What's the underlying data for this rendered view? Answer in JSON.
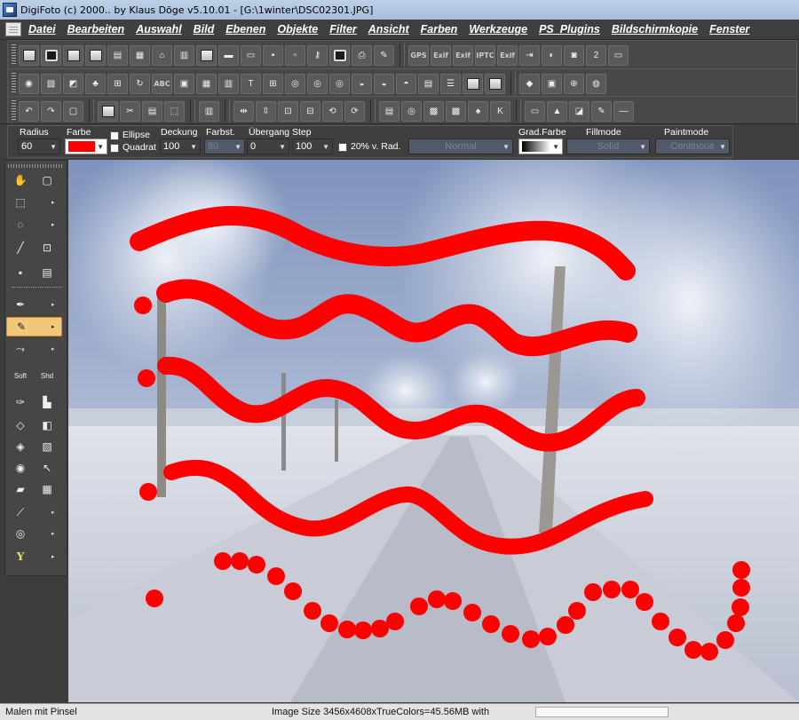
{
  "window": {
    "title": "DigiFoto (c) 2000.. by Klaus Döge v5.10.01 - [G:\\1winter\\DSC02301.JPG]"
  },
  "menu": [
    "Datei",
    "Bearbeiten",
    "Auswahl",
    "Bild",
    "Ebenen",
    "Objekte",
    "Filter",
    "Ansicht",
    "Farben",
    "Werkzeuge",
    "PS_Plugins",
    "Bildschirmkopie",
    "Fenster"
  ],
  "toolbar": {
    "row1_text_icons": [
      "GPS",
      "Exif",
      "Exif",
      "IPTC",
      "Exif"
    ],
    "row1_num_label": "2",
    "row2_text_icons": [
      "ABC"
    ]
  },
  "props": {
    "radius": {
      "label": "Radius",
      "value": "60"
    },
    "farbe": {
      "label": "Farbe",
      "color": "#ff0000"
    },
    "ellipse": {
      "label": "Ellipse",
      "checked": false
    },
    "quadrat": {
      "label": "Quadrat",
      "checked": false
    },
    "deckung": {
      "label": "Deckung",
      "value": "100"
    },
    "farbst": {
      "label": "Farbst.",
      "value": "80"
    },
    "uebergang": {
      "label": "Übergang",
      "value": "0"
    },
    "step": {
      "label": "Step",
      "value": "100"
    },
    "rad": {
      "label": "20% v. Rad.",
      "checked": false
    },
    "blend": {
      "value": "Normal"
    },
    "gradfarbe": {
      "label": "Grad.Farbe"
    },
    "fillmode": {
      "label": "Fillmode",
      "value": "Solid"
    },
    "paintmode": {
      "label": "Paintmode",
      "value": "Continous"
    }
  },
  "tools": {
    "brush_labels": [
      "Soft",
      "Shd"
    ],
    "text_tool": "Y"
  },
  "status": {
    "mode": "Malen mit Pinsel",
    "info": "Image Size 3456x4608xTrueColors=45.56MB  with"
  },
  "colors": {
    "stroke": "#ff0000",
    "ui_dark": "#3f3f3f",
    "sky": "#8fa3c8",
    "snow": "#e8ebf2"
  }
}
